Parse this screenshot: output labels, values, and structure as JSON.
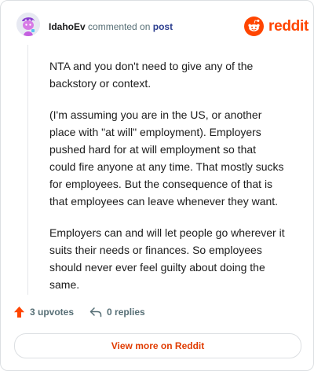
{
  "header": {
    "username": "IdahoEv",
    "action_text": "commented on",
    "post_link": "post"
  },
  "brand": {
    "wordmark": "reddit",
    "logo_icon": "reddit-snoo-icon",
    "color": "#ff4500"
  },
  "comment": {
    "paragraphs": [
      "NTA and you don't need to give any of the backstory or context.",
      "(I'm assuming you are in the US, or another place with \"at will\" employment). Employers pushed hard for at will employment so that could fire anyone at any time. That mostly sucks for employees. But the consequence of that is that employees can leave whenever they want.",
      "Employers can and will let people go wherever it suits their needs or finances. So employees should never ever feel guilty about doing the same."
    ]
  },
  "actions": {
    "upvotes": "3 upvotes",
    "upvote_icon": "upvote-arrow-icon",
    "upvote_color": "#ff4500",
    "replies": "0 replies",
    "reply_icon": "reply-arrow-icon"
  },
  "view_more": {
    "label": "View more on Reddit",
    "color": "#e03c02"
  }
}
